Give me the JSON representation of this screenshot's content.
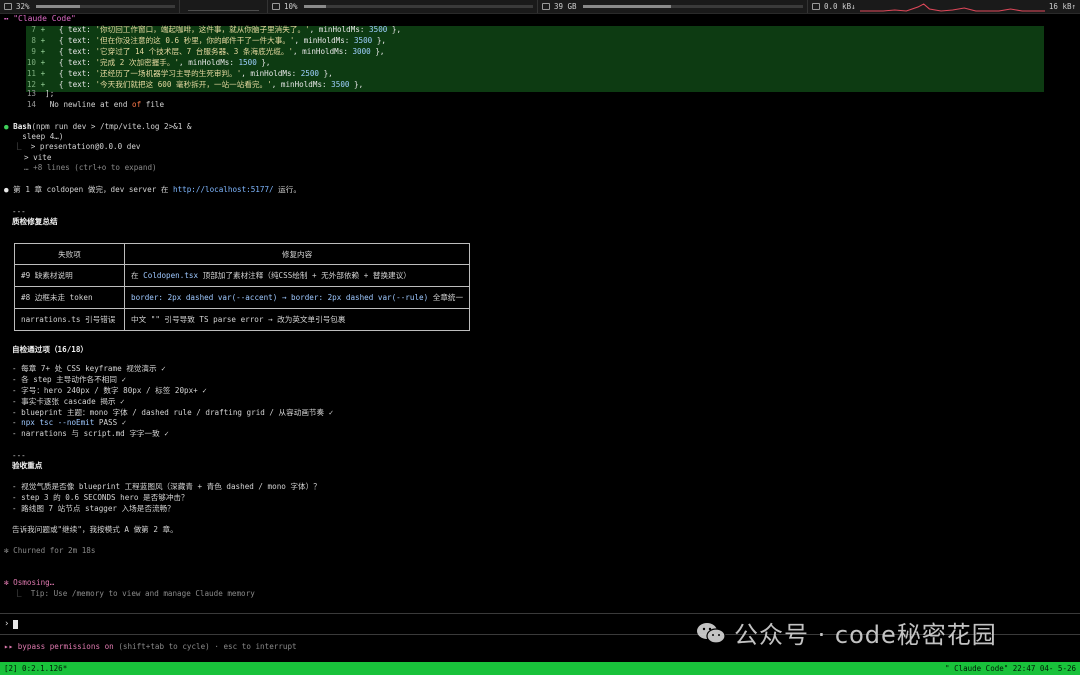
{
  "statusbar": {
    "cpu": "32%",
    "cpu_fill": 0.32,
    "mem_pct": "10%",
    "mem_fill": 0.1,
    "disk": "39 GB",
    "net_down": "0.0 kB↓",
    "net_up": "16 kB↑"
  },
  "tmux_title": "Claude Code\"",
  "tmux_title_prefix": "⬝⬝ \"",
  "diff": [
    {
      "no": "7",
      "pre": "  { text: ",
      "str": "'你切回工作窗口，端起咖啡，这件事，就从你脑子里消失了。'",
      "mid": ", minHoldMs: ",
      "num": "3500",
      "end": " },"
    },
    {
      "no": "8",
      "pre": "  { text: ",
      "str": "'但在你没注意的这 0.6 秒里，你的邮件干了一件大事。'",
      "mid": ", minHoldMs: ",
      "num": "3500",
      "end": " },"
    },
    {
      "no": "9",
      "pre": "  { text: ",
      "str": "'它穿过了 14 个技术层、7 台服务器、3 条海底光缆。'",
      "mid": ", minHoldMs: ",
      "num": "3000",
      "end": " },"
    },
    {
      "no": "10",
      "pre": "  { text: ",
      "str": "'完成 2 次加密握手。'",
      "mid": ", minHoldMs: ",
      "num": "1500",
      "end": " },"
    },
    {
      "no": "11",
      "pre": "  { text: ",
      "str": "'还经历了一场机器学习主导的生死审判。'",
      "mid": ", minHoldMs: ",
      "num": "2500",
      "end": " },"
    },
    {
      "no": "12",
      "pre": "  { text: ",
      "str": "'今天我们就把这 600 毫秒拆开，一站一站看完。'",
      "mid": ", minHoldMs: ",
      "num": "3500",
      "end": " },"
    }
  ],
  "line13": "];",
  "line13_no": "13",
  "line14_no": "14",
  "line14_a": " No newline at end ",
  "line14_of": "of",
  "line14_b": " file",
  "bash": {
    "name": "Bash",
    "cmd1": "(npm run dev > /tmp/vite.log 2>&1 &",
    "cmd2": "    sleep 4…)",
    "out1": "> presentation@0.0.0 dev",
    "out2": "> vite",
    "more": "… +8 lines (ctrl+o to expand)"
  },
  "chapter": {
    "a": "第 1 章 coldopen 做完，dev server 在 ",
    "url": "http://localhost:5177/",
    "b": " 运行。"
  },
  "sep": "---",
  "fix_title": "质检修复总结",
  "table": {
    "headers": [
      "失败项",
      "修复内容"
    ],
    "rows": [
      {
        "item": "#9 缺素材说明",
        "pre": "在 ",
        "code": "Coldopen.tsx",
        "post": " 顶部加了素材注释（纯CSS绘制 + 无外部依赖 + 替换建议）"
      },
      {
        "item": "#8 边框未走 token",
        "pre": "",
        "code": "border: 2px dashed var(--accent) → border: 2px dashed var(--rule)",
        "post": " 全章统一"
      },
      {
        "item": "narrations.ts 引号错误",
        "pre": "",
        "code": "",
        "post": "中文 \"\" 引号导致 TS parse error → 改为英文单引号包裹"
      }
    ]
  },
  "self_title": "自检通过项（16/18）",
  "self_items": [
    "- 每章 7+ 处 CSS keyframe 视觉演示 ✓",
    "- 各 step 主导动作各不相同 ✓",
    "- 字号：hero 240px / 数字 80px / 标签 20px+ ✓",
    "- 事实卡逐张 cascade 揭示 ✓",
    "- blueprint 主题：mono 字体 / dashed rule / drafting grid / 从容动画节奏 ✓"
  ],
  "tsc": {
    "pre": "- ",
    "code": "npx tsc --noEmit",
    "post": " PASS ✓"
  },
  "self_last": "- narrations 与 script.md 字字一致 ✓",
  "check_title": "验收重点",
  "check_items": [
    "- 视觉气质是否像 blueprint 工程蓝图风（深藏青 + 青色 dashed / mono 字体）？",
    "- step 3 的 0.6 SECONDS hero 是否够冲击？",
    "- 路线图 7 站节点 stagger 入场是否流畅？"
  ],
  "ask": "告诉我问题或\"继续\"，我按模式 A 做第 2 章。",
  "churned": "Churned for 2m 18s",
  "osmosing": "Osmosing…",
  "tip": "Tip: Use /memory to view and manage Claude memory",
  "prompt_symbol": "›",
  "bypass_a": "bypass permissions on",
  "bypass_b": " (shift+tab to cycle) · esc to interrupt",
  "watermark": "公众号 · code秘密花园",
  "tmux": {
    "left": "[2] 0:2.1.126*",
    "right": "\" Claude Code\" 22:47 04- 5-26"
  }
}
